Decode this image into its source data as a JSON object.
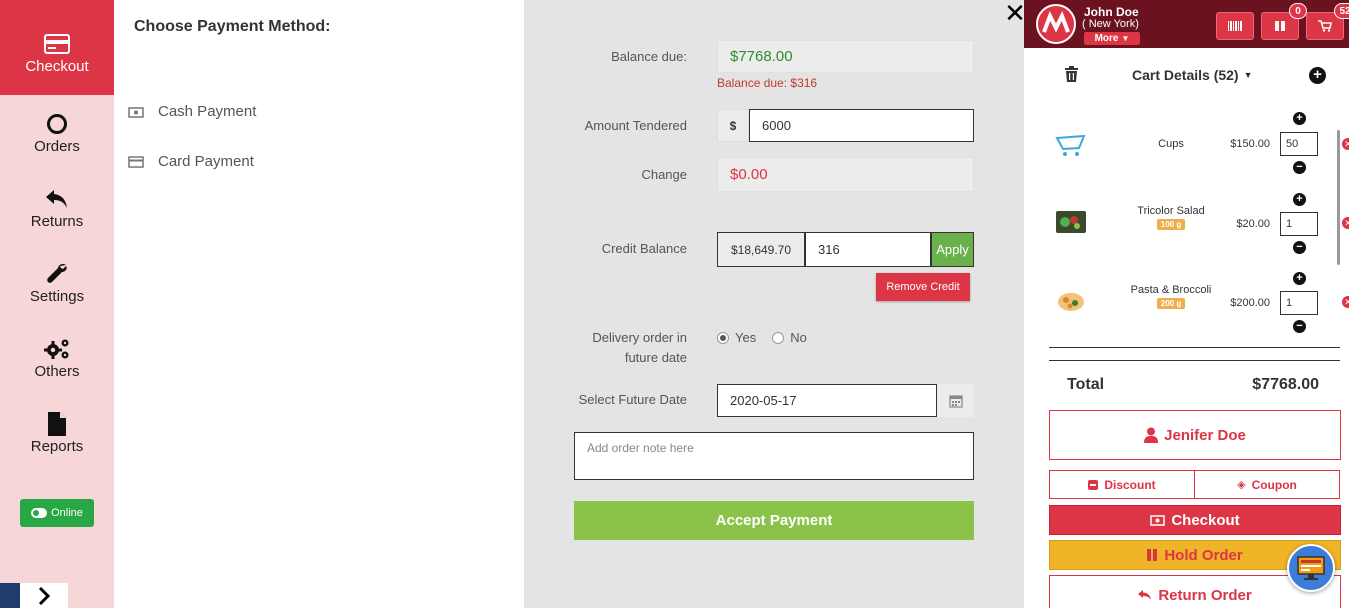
{
  "nav": {
    "items": [
      {
        "label": "Checkout"
      },
      {
        "label": "Orders"
      },
      {
        "label": "Returns"
      },
      {
        "label": "Settings"
      },
      {
        "label": "Others"
      },
      {
        "label": "Reports"
      }
    ],
    "online_label": "Online"
  },
  "methods": {
    "title": "Choose Payment Method:",
    "cash_label": "Cash Payment",
    "card_label": "Card Payment"
  },
  "form": {
    "balance_due_label": "Balance due:",
    "balance_due_value": "$7768.00",
    "balance_due_note": "Balance due: $316",
    "amount_tendered_label": "Amount Tendered",
    "currency_symbol": "$",
    "amount_tendered_value": "6000",
    "change_label": "Change",
    "change_value": "$0.00",
    "credit_balance_label": "Credit Balance",
    "credit_balance_value": "$18,649.70",
    "credit_apply_value": "316",
    "apply_label": "Apply",
    "remove_credit_label": "Remove Credit",
    "delivery_label_line1": "Delivery order in",
    "delivery_label_line2": "future date",
    "yes_label": "Yes",
    "no_label": "No",
    "future_date_label": "Select Future Date",
    "future_date_value": "2020-05-17",
    "order_note_placeholder": "Add order note here",
    "accept_label": "Accept Payment"
  },
  "header": {
    "user_name": "John Doe",
    "user_location": "( New York)",
    "more_label": "More",
    "hold_badge": "0",
    "cart_badge": "52"
  },
  "cart": {
    "title": "Cart Details (52)",
    "items": [
      {
        "name": "Cups",
        "tag": "",
        "price": "$150.00",
        "qty": "50"
      },
      {
        "name": "Tricolor Salad",
        "tag": "100 g",
        "price": "$20.00",
        "qty": "1"
      },
      {
        "name": "Pasta & Broccoli",
        "tag": "200 g",
        "price": "$200.00",
        "qty": "1"
      }
    ],
    "total_label": "Total",
    "total_value": "$7768.00",
    "customer_label": "Jenifer Doe",
    "discount_label": "Discount",
    "coupon_label": "Coupon",
    "checkout_label": "Checkout",
    "hold_label": "Hold Order",
    "return_label": "Return Order"
  },
  "colors": {
    "primary": "#dc3545",
    "header_bg": "#6b1220",
    "success": "#8bc34a",
    "warning": "#f0b429",
    "sidebar_bg": "#f6d6d6",
    "green_text": "#2e8b2e"
  }
}
